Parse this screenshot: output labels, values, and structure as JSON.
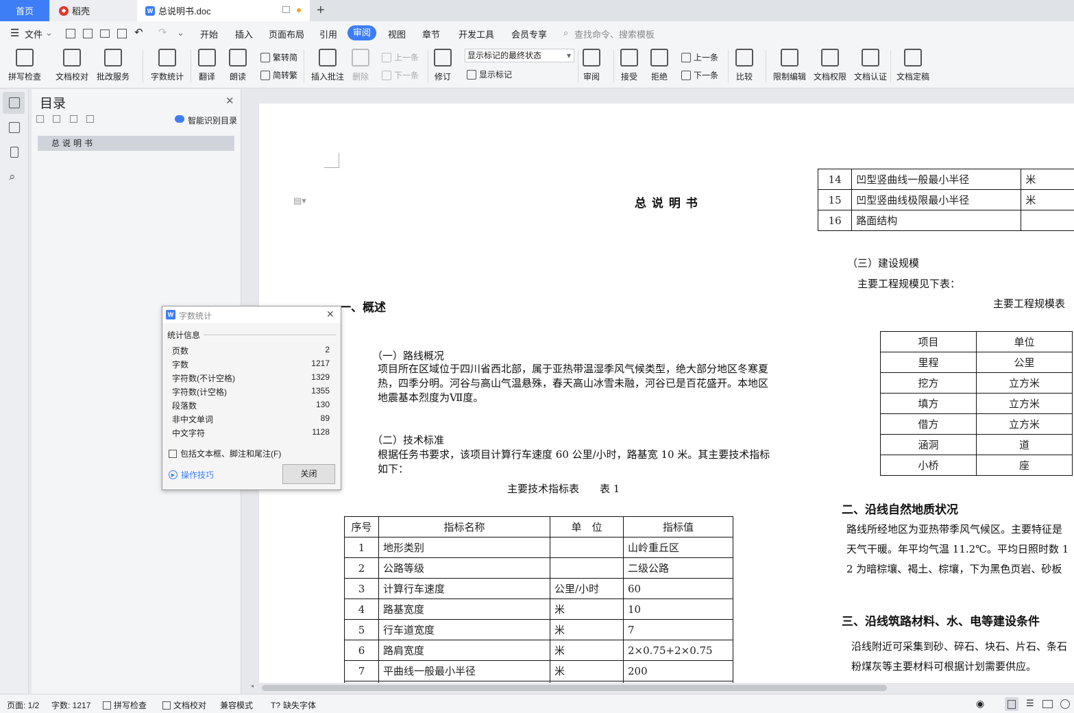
{
  "tabs": {
    "home": "首页",
    "daoke": "稻壳",
    "doc": "总说明书.doc",
    "new_tab": "+"
  },
  "menu": {
    "file": "文件",
    "items": [
      "开始",
      "插入",
      "页面布局",
      "引用",
      "审阅",
      "视图",
      "章节",
      "开发工具",
      "会员专享"
    ],
    "search_placeholder": "查找命令、搜索模板"
  },
  "ribbon": {
    "spell_check": "拼写检查",
    "doc_proof": "文档校对",
    "batch_service": "批改服务",
    "word_count": "字数统计",
    "translate": "翻译",
    "read_aloud": "朗读",
    "to_traditional": "繁转简",
    "to_simplified": "简转繁",
    "insert_comment": "插入批注",
    "delete": "删除",
    "prev": "上一条",
    "next": "下一条",
    "track": "修订",
    "mark_state": "显示标记的最终状态",
    "show_marks": "显示标记",
    "review": "审阅",
    "accept": "接受",
    "reject": "拒绝",
    "prev2": "上一条",
    "next2": "下一条",
    "compare": "比较",
    "restrict_edit": "限制编辑",
    "doc_permission": "文档权限",
    "doc_cert": "文档认证",
    "doc_final": "文档定稿"
  },
  "nav": {
    "title": "目录",
    "smart_toc": "智能识别目录",
    "item": "总说明书"
  },
  "doc": {
    "title": "总 说 明 书",
    "h1": "一、概述",
    "s1_title": "（一）路线概况",
    "s1_p1": "项目所在区域位于四川省西北部，属于亚热带温湿季风气候类型，绝大部分地区冬寒夏",
    "s1_p2": "热，四季分明。河谷与高山气温悬殊，春天高山冰雪未融，河谷已是百花盛开。本地区",
    "s1_p3": "地震基本烈度为Ⅶ度。",
    "s2_title": "（二）技术标准",
    "s2_p1": "根据任务书要求，该项目计算行车速度 60 公里/小时，路基宽 10 米。其主要技术指标",
    "s2_p2": "如下：",
    "table1_caption": "主要技术指标表　　表 1",
    "table1_headers": [
      "序号",
      "指标名称",
      "单　位",
      "指标值"
    ],
    "table1_rows": [
      [
        "1",
        "地形类别",
        "",
        "山岭重丘区"
      ],
      [
        "2",
        "公路等级",
        "",
        "二级公路"
      ],
      [
        "3",
        "计算行车速度",
        "公里/小时",
        "60"
      ],
      [
        "4",
        "路基宽度",
        "米",
        "10"
      ],
      [
        "5",
        "行车道宽度",
        "米",
        "7"
      ],
      [
        "6",
        "路肩宽度",
        "米",
        "2×0.75+2×0.75"
      ],
      [
        "7",
        "平曲线一般最小半径",
        "米",
        "200"
      ]
    ],
    "table1b_rows": [
      [
        "14",
        "凹型竖曲线一般最小半径",
        "米"
      ],
      [
        "15",
        "凹型竖曲线极限最小半径",
        "米"
      ],
      [
        "16",
        "路面结构",
        ""
      ]
    ],
    "s3_title": "（三）建设规模",
    "s3_p1": "主要工程规模见下表：",
    "table2_caption": "主要工程规模表",
    "table2_headers": [
      "项目",
      "单位"
    ],
    "table2_rows": [
      [
        "里程",
        "公里"
      ],
      [
        "挖方",
        "立方米"
      ],
      [
        "填方",
        "立方米"
      ],
      [
        "借方",
        "立方米"
      ],
      [
        "涵洞",
        "道"
      ],
      [
        "小桥",
        "座"
      ]
    ],
    "h2": "二、沿线自然地质状况",
    "h2_p1": "路线所经地区为亚热带季风气候区。主要特征是",
    "h2_p2": "天气干暖。年平均气温 11.2℃。平均日照时数 1",
    "h2_p3": "2 为暗棕壤、褐土、棕壤，下为黑色页岩、砂板",
    "h3": "三、沿线筑路材料、水、电等建设条件",
    "h3_p1": "沿线附近可采集到砂、碎石、块石、片石、条石",
    "h3_p2": "粉煤灰等主要材料可根据计划需要供应。"
  },
  "dialog": {
    "title": "字数统计",
    "section": "统计信息",
    "rows": [
      [
        "页数",
        "2"
      ],
      [
        "字数",
        "1217"
      ],
      [
        "字符数(不计空格)",
        "1329"
      ],
      [
        "字符数(计空格)",
        "1355"
      ],
      [
        "段落数",
        "130"
      ],
      [
        "非中文单词",
        "89"
      ],
      [
        "中文字符",
        "1128"
      ]
    ],
    "include_label": "包括文本框、脚注和尾注(F)",
    "tips": "操作技巧",
    "close": "关闭"
  },
  "status": {
    "page": "页面: 1/2",
    "words": "字数: 1217",
    "spell": "拼写检查",
    "proof": "文档校对",
    "compat": "兼容模式",
    "missing_font": "缺失字体"
  },
  "colors": {
    "accent": "#3d7ef6",
    "daoke_red": "#e0352b"
  }
}
